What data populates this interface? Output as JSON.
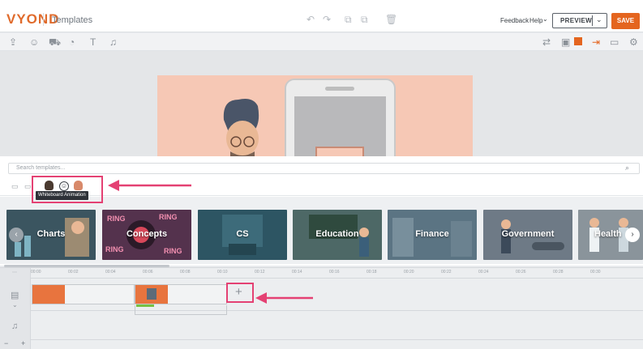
{
  "app": {
    "logo": "VYOND",
    "title": "Templates"
  },
  "header": {
    "feedback_label": "Feedback",
    "help_label": "Help",
    "preview_label": "PREVIEW",
    "save_label": "SAVE"
  },
  "panel": {
    "search_placeholder": "Search templates...",
    "tooltip": "Whiteboard Animation",
    "categories": [
      {
        "label": "Charts",
        "color": "#3b5560"
      },
      {
        "label": "Concepts",
        "color": "#54324d"
      },
      {
        "label": "CS",
        "color": "#2d5563"
      },
      {
        "label": "Education",
        "color": "#4d6866"
      },
      {
        "label": "Finance",
        "color": "#5b7483"
      },
      {
        "label": "Government",
        "color": "#6e7a86"
      },
      {
        "label": "Health",
        "color": "#8a949b"
      }
    ],
    "concepts_deco": "RING"
  },
  "timeline": {
    "ruler": [
      "00:00",
      "00:02",
      "00:04",
      "00:06",
      "00:08",
      "00:10",
      "00:12",
      "00:14",
      "00:16",
      "00:18",
      "00:20",
      "00:22",
      "00:24",
      "00:26",
      "00:28",
      "00:30",
      "00:32",
      "00:34",
      "00:36"
    ],
    "add_scene_label": "+"
  },
  "colors": {
    "accent": "#e4651f",
    "highlight": "#e44173",
    "progress": "#77c043"
  }
}
